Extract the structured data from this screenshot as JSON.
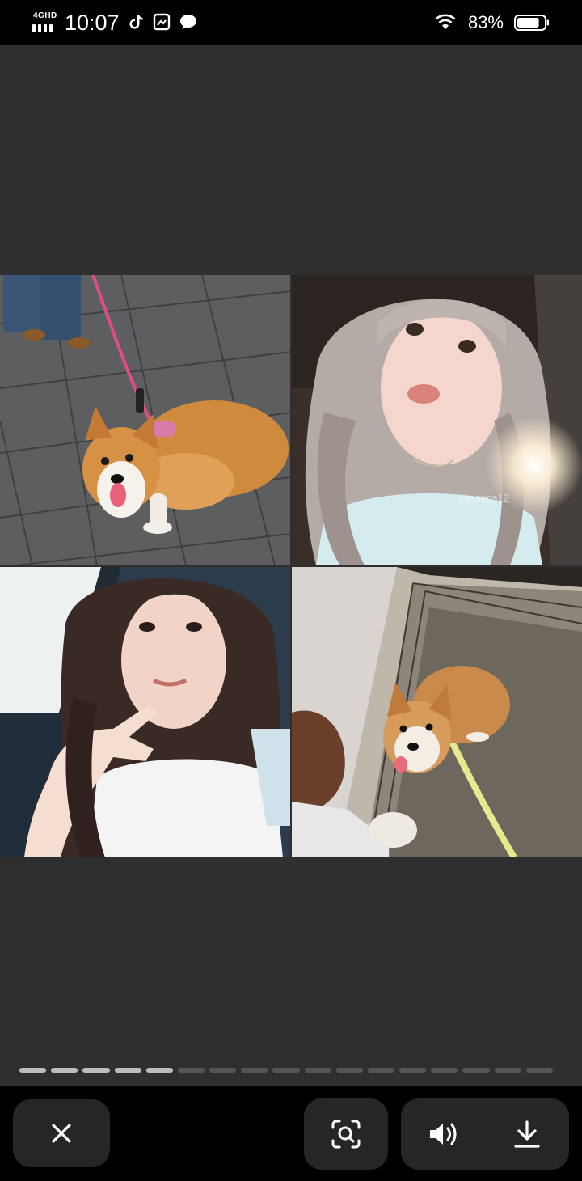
{
  "status_bar": {
    "network": "4GHD",
    "time": "10:07",
    "battery_percent": "83%",
    "battery_level": 0.83,
    "app_icons": [
      "tiktok-icon",
      "photo-app-icon",
      "message-bubble-icon"
    ]
  },
  "viewer": {
    "photos": [
      {
        "subject": "corgi-on-leash"
      },
      {
        "subject": "selfie-light-hair"
      },
      {
        "subject": "selfie-dark-hair"
      },
      {
        "subject": "corgi-puppy-on-rug"
      }
    ],
    "watermark": "cassens12",
    "progress": {
      "total_segments": 17,
      "current": 5
    }
  },
  "actions": {
    "close_icon": "close-icon",
    "scan_icon": "lens-search-icon",
    "sound_icon": "speaker-icon",
    "download_icon": "download-icon"
  }
}
